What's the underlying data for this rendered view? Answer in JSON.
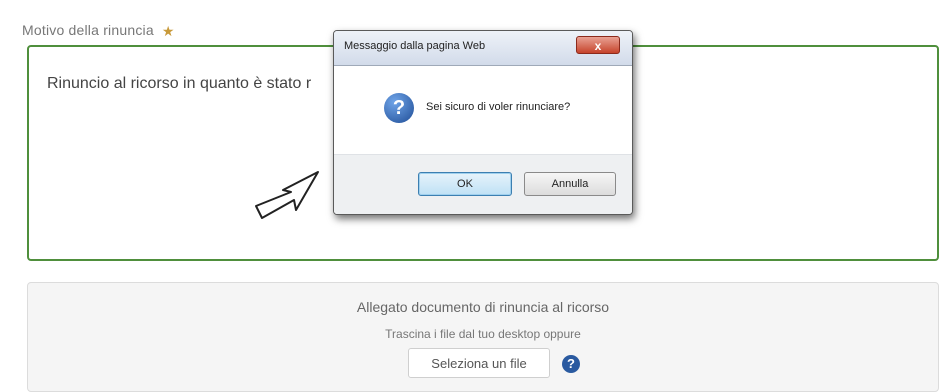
{
  "form": {
    "reason_label": "Motivo della rinuncia",
    "reason_value": "Rinuncio al ricorso in quanto è stato r",
    "attachment_title": "Allegato documento di rinuncia al ricorso",
    "attachment_hint": "Trascina i file dal tuo desktop oppure",
    "select_file_label": "Seleziona un file",
    "help_glyph": "?"
  },
  "dialog": {
    "title": "Messaggio dalla pagina Web",
    "close_glyph": "x",
    "message": "Sei sicuro di voler rinunciare?",
    "ok_label": "OK",
    "cancel_label": "Annulla"
  },
  "colors": {
    "accent_green": "#4f8f3c",
    "required_star": "#c89a3a",
    "help_blue": "#2a5aa0"
  },
  "icons": [
    "required-star-icon",
    "help-icon",
    "question-icon",
    "mouse-cursor-icon",
    "close-icon"
  ]
}
